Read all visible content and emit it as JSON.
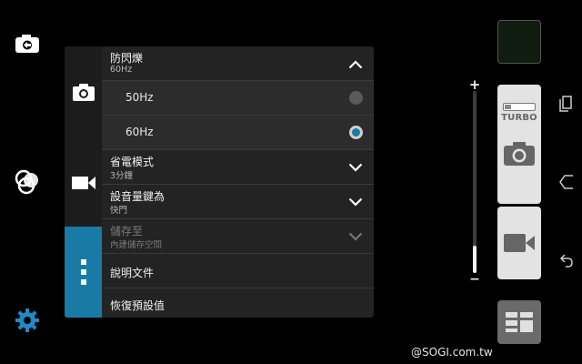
{
  "left_icons": {
    "switch_camera": "switch-camera-icon",
    "filters": "filters-icon",
    "settings": "settings-icon",
    "settings_color": "#1f8ac4"
  },
  "panel": {
    "tabs": [
      "camera-tab",
      "video-tab",
      "more-tab"
    ],
    "accent": "#1a7aa6",
    "rows": [
      {
        "title": "防閃爍",
        "value": "60Hz",
        "expanded": true
      },
      {
        "title": "省電模式",
        "value": "3分鐘"
      },
      {
        "title": "設音量鍵為",
        "value": "快門"
      },
      {
        "title": "儲存至",
        "value": "內建儲存空間",
        "disabled": true
      },
      {
        "title": "說明文件"
      },
      {
        "title": "恢復預設值"
      }
    ],
    "options": [
      {
        "label": "50Hz",
        "selected": false
      },
      {
        "label": "60Hz",
        "selected": true
      }
    ]
  },
  "right_controls": {
    "zoom_plus": "+",
    "zoom_minus": "−",
    "zoom_level": 0.15,
    "turbo_label": "TURBO",
    "shutter_icon": "camera-icon",
    "video_icon": "video-icon",
    "mode_icon": "grid-icon"
  },
  "nav": [
    "recent-apps-icon",
    "home-icon",
    "back-icon"
  ],
  "watermark": "@SOGI.com.tw"
}
